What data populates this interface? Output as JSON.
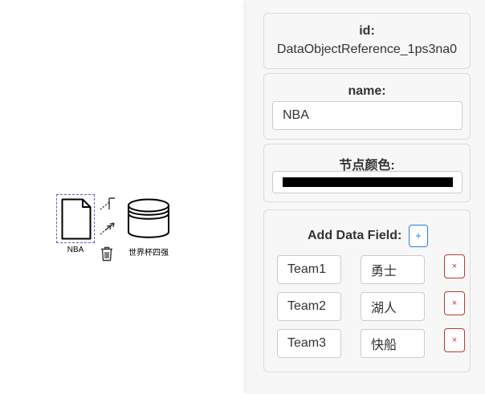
{
  "canvas": {
    "document_node_label": "NBA",
    "datastore_node_label": "世界杯四强",
    "context_icons": [
      "connector-icon",
      "arrow-connector-icon",
      "trash-icon"
    ]
  },
  "panel": {
    "id_section": {
      "label": "id:",
      "value": "DataObjectReference_1ps3na0"
    },
    "name_section": {
      "label": "name:",
      "value": "NBA"
    },
    "color_section": {
      "label": "节点颜色:",
      "value": "#000000"
    },
    "data_fields": {
      "label": "Add Data Field:",
      "add_button": "+",
      "delete_button": "×",
      "rows": [
        {
          "key": "Team1",
          "value": "勇士"
        },
        {
          "key": "Team2",
          "value": "湖人"
        },
        {
          "key": "Team3",
          "value": "快船"
        }
      ]
    }
  },
  "colors": {
    "selection_border": "#5b5bd6",
    "add_button": "#2b7de9",
    "delete_button": "#c0392b",
    "panel_background": "#f7f7f7"
  }
}
